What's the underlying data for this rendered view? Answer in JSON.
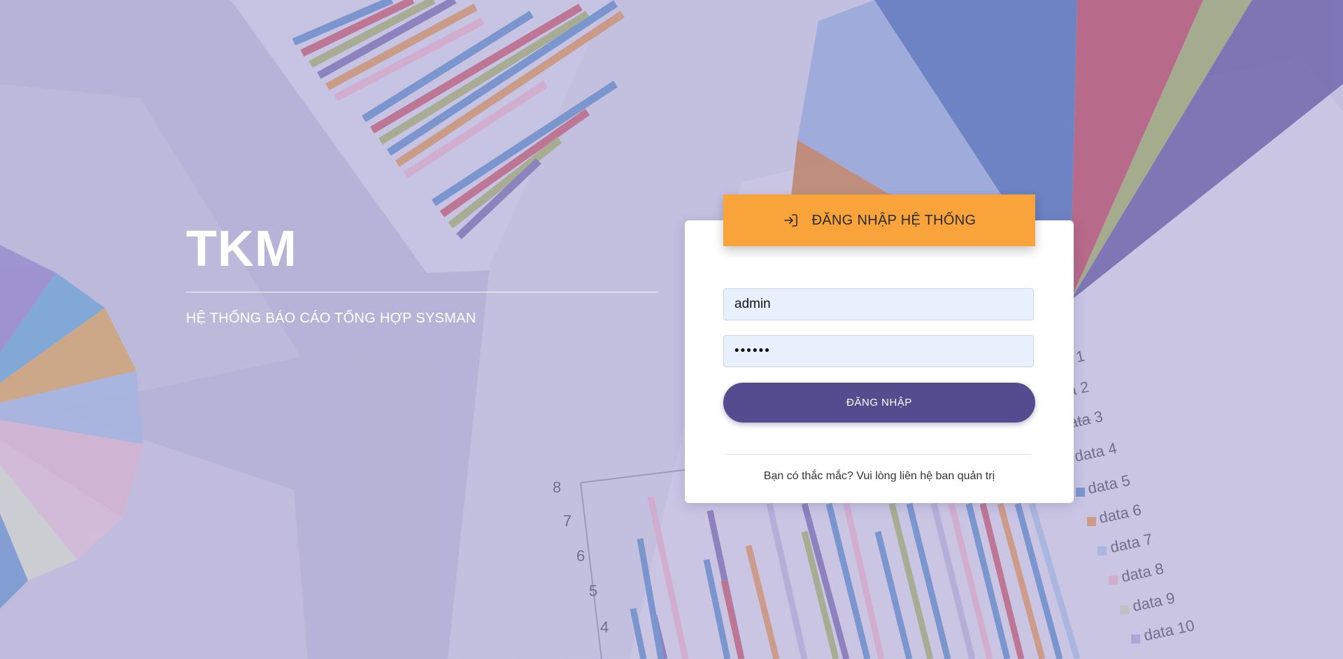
{
  "brand": {
    "title": "TKM",
    "subtitle": "HỆ THỐNG BÁO CÁO TỔNG HỢP SYSMAN"
  },
  "login": {
    "header_title": "ĐĂNG NHẬP HỆ THỐNG",
    "header_icon": "login-icon",
    "username_value": "admin",
    "password_value": "••••••",
    "submit_label": "ĐĂNG NHẬP",
    "help_text": "Bạn có thắc mắc? Vui lòng liên hệ ban quản trị"
  },
  "background": {
    "chart_y_ticks": [
      "8",
      "7",
      "6",
      "5",
      "4"
    ],
    "chart_legend_items": [
      "1",
      "a 2",
      "ata 3",
      "data 4",
      "data 5",
      "data 6",
      "data 7",
      "data 8",
      "data 9",
      "data 10"
    ]
  },
  "colors": {
    "header_accent": "#f9a43b",
    "button_primary": "#544c8e",
    "input_fill": "#e8f0fe",
    "card": "#ffffff"
  }
}
